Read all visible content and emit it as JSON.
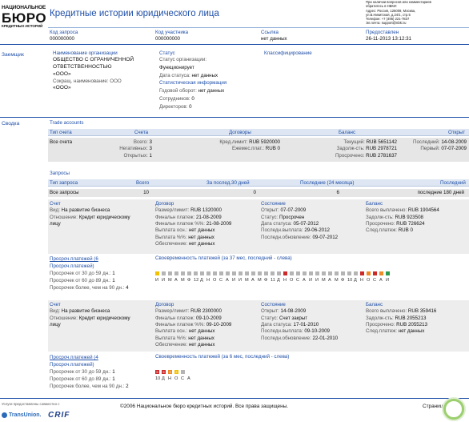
{
  "header": {
    "logo": {
      "line1": "НАЦИОНАЛЬНОЕ",
      "line2": "БЮРО",
      "line3": "КРЕДИТНЫХ ИСТОРИЙ"
    },
    "title": "Кредитные истории юридического лица",
    "contact": [
      "При наличии вопросов или комментариев",
      "обратитесь в НБКИ:",
      "Адрес: Россия, 125009, Москва,",
      "ул.Б.Никитская, д.24/1, стр.5",
      "Телефон: +7 (495) 221-7837",
      "Эл.почта: support@nbki.ru"
    ]
  },
  "request": {
    "cols": [
      {
        "label": "Код запроса",
        "value": "000000000"
      },
      {
        "label": "Код участника",
        "value": "000000000"
      },
      {
        "label": "Ссылка",
        "value": "нет данных"
      },
      {
        "label": "Предоставлен",
        "value": "26-11-2013 13:12:31"
      }
    ]
  },
  "borrower": {
    "section": "Заемщик",
    "name_label": "Наименование организации",
    "name_lines": [
      "ОБЩЕСТВО С ОГРАНИЧЕННОЙ",
      "ОТВЕТСТВЕННОСТЬЮ",
      "«ООО»"
    ],
    "short_label": "Сокращ. наименование: ООО",
    "short_value": "«ООО»",
    "status_title": "Статус",
    "status_org_label": "Статус организации:",
    "status_org_value": "Функционирует",
    "status_date_label": "Дата статуса:",
    "status_date_value": "нет данных",
    "stats_title": "Статистическая информация",
    "turnover_label": "Годовой оборот:",
    "turnover_value": "нет данных",
    "staff_label": "Сотрудников:",
    "staff_value": "0",
    "directors_label": "Директоров:",
    "directors_value": "0",
    "class_title": "Классифицирование"
  },
  "summary": {
    "section": "Сводка",
    "trade_title": "Trade accounts",
    "trade_headers": [
      "Тип счета",
      "Счета",
      "Договоры",
      "Баланс",
      "Открыт"
    ],
    "trade_row_label": "Все счета",
    "trade_accounts": [
      [
        "Всего:",
        "3"
      ],
      [
        "Негативных:",
        "3"
      ],
      [
        "Открытых:",
        "1"
      ]
    ],
    "trade_contracts": [
      [
        "Кред.лимит:",
        "RUB 5920000"
      ],
      [
        "Ежемес.плат.:",
        "RUB 0"
      ]
    ],
    "trade_balance": [
      [
        "Текущий:",
        "RUB 5651142"
      ],
      [
        "Задолж-сть:",
        "RUB 2978721"
      ],
      [
        "Просрочено:",
        "RUB 2781637"
      ]
    ],
    "trade_opened": [
      [
        "Последний:",
        "14-08-2009"
      ],
      [
        "Первый:",
        "07-07-2009"
      ]
    ],
    "req_title": "Запросы",
    "req_headers": [
      "Тип запроса",
      "Всего",
      "За послед.30 дней",
      "Последние (24 месяца)",
      "Последний"
    ],
    "req_row": [
      "Все запросы",
      "10",
      "0",
      "6",
      "последние 180 дней"
    ]
  },
  "accounts": [
    {
      "titles": {
        "acct": "Счет",
        "contract": "Договор",
        "state": "Состояние",
        "balance": "Баланс"
      },
      "acct": {
        "kind_label": "Вид:",
        "kind_value": "На развитие бизнеса",
        "rel_label": "Отношение:",
        "rel_value": "Кредит юридическому",
        "rel_value2": "лицу"
      },
      "contract": [
        [
          "Размер/лимит:",
          "RUB 1320000"
        ],
        [
          "Финальн платеж:",
          "21-08-2009"
        ],
        [
          "Финальн платеж %%:",
          "21-08-2009"
        ],
        [
          "Выплата осн.:",
          "нет данных"
        ],
        [
          "Выплата %%:",
          "нет данных"
        ],
        [
          "Обеспечение:",
          "нет данных"
        ]
      ],
      "state": [
        [
          "Открыт:",
          "07-07-2009"
        ],
        [
          "Статус:",
          "Просрочен"
        ],
        [
          "Дата статуса:",
          "05-07-2012"
        ],
        [
          "Последн.выплата:",
          "29-06-2012"
        ],
        [
          "Последн.обновление:",
          "09-07-2012"
        ]
      ],
      "balance": [
        [
          "Всего выплачено:",
          "RUB 1904564"
        ],
        [
          "Задолж-сть:",
          "RUB 923508"
        ],
        [
          "Просрочено:",
          "RUB 726624"
        ],
        [
          "След.платеж:",
          "RUB 0"
        ]
      ],
      "delq_title": "Просроч.платежей (6",
      "delq_title2": "Просроч.платежей)",
      "delq": [
        [
          "Просрочек от 30 до 59 дн.:",
          "1"
        ],
        [
          "Просрочек от 60 до 89 дн.:",
          "1"
        ],
        [
          "Просрочек более, чем на 90 дн.:",
          "4"
        ]
      ],
      "timeliness_title": "Своевременность платежей (за 37 мес, последний - слева)",
      "squares": [
        "y",
        "g",
        "g",
        "g",
        "g",
        "g",
        "g",
        "g",
        "g",
        "g",
        "g",
        "g",
        "g",
        "g",
        "g",
        "g",
        "g",
        "g",
        "g",
        "g",
        "r",
        "g",
        "g",
        "g",
        "g",
        "g",
        "g",
        "g",
        "g",
        "g",
        "g",
        "g",
        "r",
        "o",
        "r",
        "o",
        "gr"
      ],
      "months": [
        "И",
        "И",
        "М",
        "А",
        "М",
        "Ф",
        "12",
        "Д",
        "Н",
        "О",
        "С",
        "А",
        "И",
        "И",
        "М",
        "А",
        "М",
        "Ф",
        "11",
        "Д",
        "Н",
        "О",
        "С",
        "А",
        "И",
        "И",
        "М",
        "А",
        "М",
        "Ф",
        "10",
        "Д",
        "Н",
        "О",
        "С",
        "А",
        "И"
      ]
    },
    {
      "titles": {
        "acct": "Счет",
        "contract": "Договор",
        "state": "Состояние",
        "balance": "Баланс"
      },
      "acct": {
        "kind_label": "Вид:",
        "kind_value": "На развитие бизнеса",
        "rel_label": "Отношение:",
        "rel_value": "Кредит юридическому",
        "rel_value2": "лицу"
      },
      "contract": [
        [
          "Размер/лимит:",
          "RUB 2300000"
        ],
        [
          "Финальн платеж:",
          "09-10-2009"
        ],
        [
          "Финальн платеж %%:",
          "09-10-2009"
        ],
        [
          "Выплата осн.:",
          "нет данных"
        ],
        [
          "Выплата %%:",
          "нет данных"
        ],
        [
          "Обеспечение:",
          "нет данных"
        ]
      ],
      "state": [
        [
          "Открыт:",
          "14-08-2009"
        ],
        [
          "Статус:",
          "Счет закрыт"
        ],
        [
          "Дата статуса:",
          "17-01-2010"
        ],
        [
          "Последн.выплата:",
          "09-10-2009"
        ],
        [
          "Последн.обновление:",
          "22-01-2010"
        ]
      ],
      "balance": [
        [
          "Всего выплачено:",
          "RUB 359416"
        ],
        [
          "Задолж-сть:",
          "RUB 2055213"
        ],
        [
          "Просрочено:",
          "RUB 2055213"
        ],
        [
          "След.платеж:",
          "нет данных"
        ]
      ],
      "delq_title": "Просроч.платежей (4",
      "delq_title2": "Просроч.платежей)",
      "delq": [
        [
          "Просрочек от 30 до 59 дн.:",
          "1"
        ],
        [
          "Просрочек от 60 до 89 дн.:",
          "1"
        ],
        [
          "Просрочек более, чем на 90 дн.:",
          "2"
        ]
      ],
      "timeliness_title": "Своевременность платежей (за 6 мес, последний - слева)",
      "squares": [
        "r",
        "r",
        "o",
        "y",
        "g"
      ],
      "square_marks": [
        "5",
        "5",
        "3",
        "2",
        ""
      ],
      "months": [
        "10",
        "Д",
        "Н",
        "О",
        "С",
        "А"
      ]
    }
  ],
  "footer": {
    "provided": "Услуги предоставлены совместно с",
    "brand1": "TransUnion.",
    "brand2": "CRIF",
    "copyright": "©2006 Национальное бюро кредитных историй. Все права защищены.",
    "page": "Страниц"
  }
}
